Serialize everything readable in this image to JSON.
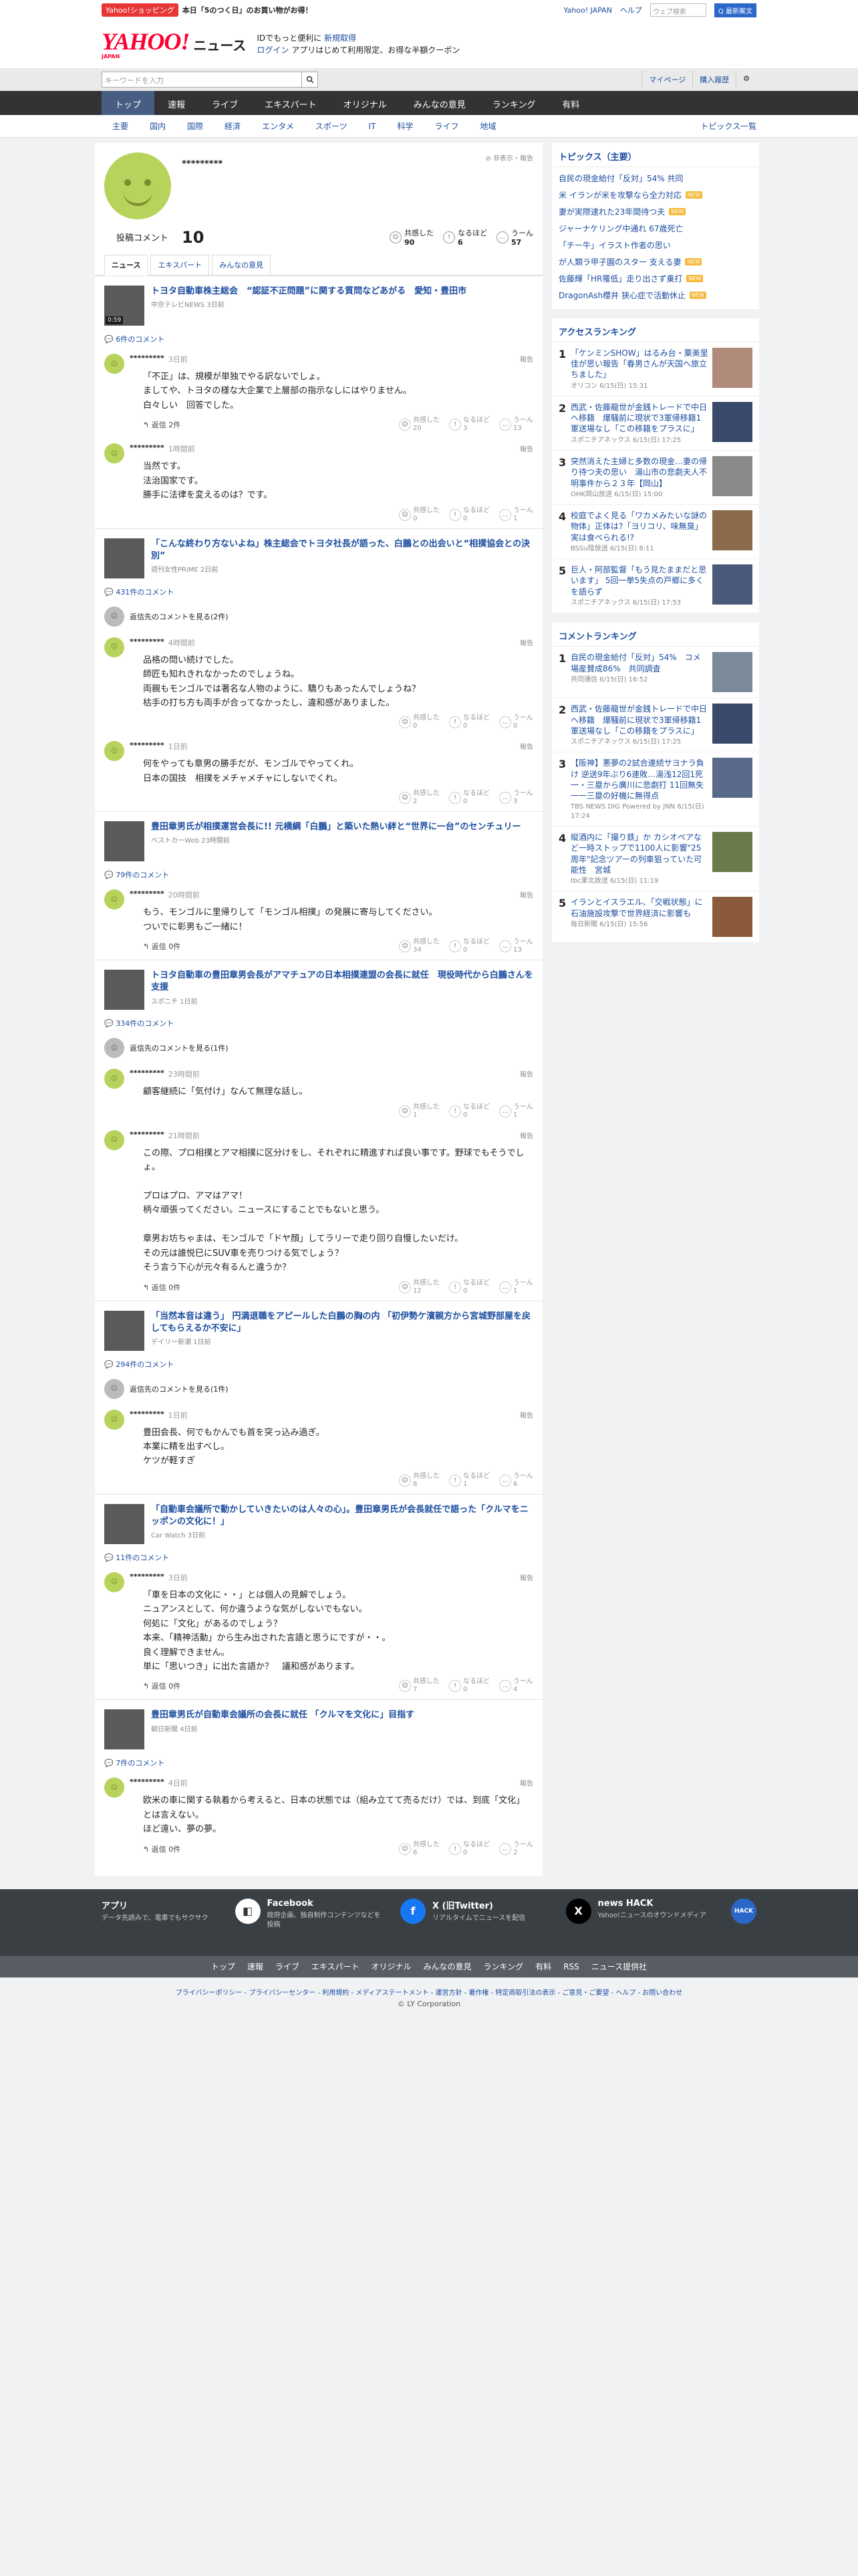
{
  "topbar": {
    "shop_badge": "Yahoo!ショッピング",
    "promo": "本日「5のつく日」のお買い物がお得！",
    "yahoo_japan": "Yahoo! JAPAN",
    "help": "ヘルプ",
    "search_placeholder": "ウェブ検索",
    "search_btn": "Q 最新案文"
  },
  "header": {
    "logo": "YAHOO!",
    "logo_sub": "JAPAN",
    "news": "ニュース",
    "msg1": "IDでもっと便利に",
    "msg1_link": "新規取得",
    "login": "ログイン",
    "msg2": "アプリはじめて利用限定、お得な半額クーポン"
  },
  "search": {
    "placeholder": "キーワードを入力",
    "mypage": "マイページ",
    "history": "購入履歴"
  },
  "gnav": [
    "トップ",
    "速報",
    "ライブ",
    "エキスパート",
    "オリジナル",
    "みんなの意見",
    "ランキング",
    "有料"
  ],
  "snav": [
    "主要",
    "国内",
    "国際",
    "経済",
    "エンタメ",
    "スポーツ",
    "IT",
    "科学",
    "ライフ",
    "地域"
  ],
  "snav_right": "トピックス一覧",
  "profile": {
    "name": "*********",
    "report": "非表示・報告",
    "comment_label": "投稿コメント",
    "comment_count": "10",
    "reacts": [
      {
        "label": "共感した",
        "count": "90"
      },
      {
        "label": "なるほど",
        "count": "6"
      },
      {
        "label": "うーん",
        "count": "57"
      }
    ]
  },
  "tabs": [
    "ニュース",
    "エキスパート",
    "みんなの意見"
  ],
  "reply_btn": "返信 2件",
  "report": "報告",
  "see_parent": "返信先のコメントを見る(2件)",
  "articles": [
    {
      "title": "トヨタ自動車株主総会　“認証不正問題”に関する質問などあがる　愛知・豊田市",
      "source": "中京テレビNEWS 3日前",
      "ccount": "6件のコメント",
      "vid": "0:59"
    },
    {
      "title": "「こんな終わり方ないよね」株主総会でトヨタ社長が語った、白鵬との出会いと“相撲協会との決別”",
      "source": "週刊女性PRIME 2日前",
      "ccount": "431件のコメント"
    },
    {
      "title": "豊田章男氏が相撲運営会長に!! 元横綱「白鵬」と築いた熱い絆と“世界に一台”のセンチュリー",
      "source": "ベストカーWeb 23時間前",
      "ccount": "79件のコメント"
    },
    {
      "title": "トヨタ自動車の豊田章男会長がアマチュアの日本相撲連盟の会長に就任　現役時代から白鵬さんを支援",
      "source": "スポニチ 1日前",
      "ccount": "334件のコメント"
    },
    {
      "title": "「当然本音は違う」 円満退職をアピールした白鵬の胸の内 「初伊勢ケ濱親方から宮城野部屋を戻してもらえるか不安に」",
      "source": "デイリー新潮 1日前",
      "ccount": "294件のコメント"
    },
    {
      "title": "「自動車会議所で動かしていきたいのは人々の心」。豊田章男氏が会長就任で語った「クルマをニッポンの文化に！」",
      "source": "Car Watch 3日前",
      "ccount": "11件のコメント"
    },
    {
      "title": "豊田章男氏が自動車会議所の会長に就任 「クルマを文化に」目指す",
      "source": "朝日新聞 4日前",
      "ccount": "7件のコメント"
    }
  ],
  "comments": [
    {
      "user": "*********",
      "time": "3日前",
      "text": "「不正」は、規模が単独でやる訳ないでしょ。\nましてや、トヨタの様な大企業で上層部の指示なしにはやりません。\n白々しい　回答でした。",
      "reply": "返信 2件",
      "r": [
        "20",
        "3",
        "13"
      ]
    },
    {
      "user": "*********",
      "time": "1時間前",
      "text": "当然です。\n法治国家です。\n勝手に法律を変えるのは？です。",
      "r": [
        "0",
        "0",
        "1"
      ]
    },
    {
      "user": "*********",
      "time": "4時間前",
      "text": "品格の問い続けでした。\n師匠も知れきれなかったのでしょうね。\n両親もモンゴルでは著名な人物のように、驕りもあったんでしょうね？\n枯手の打ち方も両手が合ってなかったし、違和感がありました。",
      "r": [
        "0",
        "0",
        "0"
      ]
    },
    {
      "user": "*********",
      "time": "1日前",
      "text": "何をやっても章男の勝手だが、モンゴルでやってくれ。\n日本の国技　相撲をメチャメチャにしないでくれ。",
      "r": [
        "2",
        "0",
        "3"
      ]
    },
    {
      "user": "*********",
      "time": "20時間前",
      "text": "もう、モンゴルに里帰りして「モンゴル相撲」の発展に寄与してください。\nついでに彰男もご一緒に！",
      "reply": "返信 0件",
      "r": [
        "34",
        "0",
        "13"
      ]
    },
    {
      "user": "*********",
      "time": "23時間前",
      "text": "顧客継続に「気付け」なんて無理な話し。",
      "r": [
        "1",
        "0",
        "1"
      ]
    },
    {
      "user": "*********",
      "time": "21時間前",
      "text": "この際、プロ相撲とアマ相撲に区分けをし、それぞれに精進すれば良い事です。野球でもそうでしょ。\n\nプロはプロ、アマはアマ！\n柄々頑張ってください。ニュースにすることでもないと思う。\n\n章男お坊ちゃまは、モンゴルで「ドヤ顔」してラリーで走り回り自慢したいだけ。\nその元は誰悦巳にSUV車を売りつける気でしょう？\nそう言う下心が元々有るんと違うか？",
      "reply": "返信 0件",
      "r": [
        "12",
        "0",
        "1"
      ]
    },
    {
      "user": "*********",
      "time": "1日前",
      "text": "豊田会長、何でもかんでも首を突っ込み過ぎ。\n本業に精を出すべし。\nケツが軽すぎ",
      "r": [
        "8",
        "1",
        "6"
      ]
    },
    {
      "user": "*********",
      "time": "3日前",
      "text": "「車を日本の文化に・・」とは個人の見解でしょう。\nニュアンスとして、何か違うような気がしないでもない。\n何処に「文化」があるのでしょう？\n本来、「精神活動」から生み出された言語と思うにですが・・。\n良く理解できません。\n単に「思いつき」に出た言語か？　議和感があります。",
      "reply": "返信 0件",
      "r": [
        "7",
        "0",
        "4"
      ]
    },
    {
      "user": "*********",
      "time": "4日前",
      "text": "欧米の車に関する執着から考えると、日本の状態では（組み立てて売るだけ）では、到底「文化」とは言えない。\nほど遠い、夢の夢。",
      "reply": "返信 0件",
      "r": [
        "6",
        "0",
        "2"
      ]
    }
  ],
  "side": {
    "topics_title": "トピックス（主要）",
    "topics": [
      "自民の現金給付「反対」54% 共同",
      "米 イランが米を攻撃なら全力対応",
      "妻が実際逮れた23年間待つ夫",
      "ジャーナケリング中通れ 67歳死亡",
      "「チー牛」イラスト作者の思い",
      "が人類ラ甲子園のスター 支える妻",
      "佐藤輝「HR罹低」走り出さず乗打",
      "DragonAsh櫻井 狭心症で活動休止"
    ],
    "access_title": "アクセスランキング",
    "access": [
      {
        "t": "「ケンミンSHOW」はるみ台・粟美里佳が思い報告「春男さんが天国へ旅立ちました」",
        "m": "オリコン 6/15(日) 15:31"
      },
      {
        "t": "西武・佐藤龍世が金銭トレードで中日へ移籍　爆騒前に現状で3軍帰移籍1軍送場なし「この移籍をプラスに」",
        "m": "スポニチアネックス 6/15(日) 17:25"
      },
      {
        "t": "突然消えた主婦と多数の現金…妻の帰り待つ夫の思い　湯山市の悲劇夫人不明事件から２３年【岡山】",
        "m": "OHK岡山放送 6/15(日) 15:00"
      },
      {
        "t": "校庭でよく見る「ワカメみたいな謎の物体」正体は?「ヨリコリ、味無臭」実は食べられる!?",
        "m": "BSSu陰放送 6/15(日) 8:11"
      },
      {
        "t": "巨人・阿部監督「もう見たままだと思います」 5回一挙5失点の戸郷に多くを語らず",
        "m": "スポニチアネックス 6/15(日) 17:53"
      }
    ],
    "comment_title": "コメントランキング",
    "crank": [
      {
        "t": "自民の現金給付「反対」54%　コメ場産賛成86%　共同調査",
        "m": "共同通信 6/15(日) 16:52"
      },
      {
        "t": "西武・佐藤龍世が金銭トレードで中日へ移籍　爆騒前に現状で3軍帰移籍1軍送場なし「この移籍をプラスに」",
        "m": "スポニチアネックス 6/15(日) 17:25"
      },
      {
        "t": "【阪神】悪夢の2試合連続サヨナラ負け 逆送9年ぶり6連敗…湯浅12回1死一・三塁から廣川に悲劇打 11回無失一一三塁の好機に無得点",
        "m": "TBS NEWS DIG Powered by JNN 6/15(日) 17:24"
      },
      {
        "t": "縦酒内に「撮り鉄」か カシオペアなど一時ストップで1100人に影響\"25周年\"記念ツアーの列車狙っていた可能性　宮城",
        "m": "tbc東北放送 6/15(日) 11:19"
      },
      {
        "t": "イランとイスラエル、「交戦状態」に　石油施設攻撃で世界経済に影響も",
        "m": "毎日新聞 6/15(日) 15:56"
      }
    ]
  },
  "footer": {
    "apps": [
      {
        "title": "アプリ",
        "desc": "データ先読みで、電車でもサクサク"
      },
      {
        "title": "Facebook",
        "desc": "政府企画、独自制作コンテンツなどを投稿"
      },
      {
        "title": "X (旧Twitter)",
        "desc": "リアルタイムでニュースを配信"
      },
      {
        "title": "news HACK",
        "desc": "Yahoo!ニュースのオウンドメディア"
      }
    ],
    "links": [
      "トップ",
      "速報",
      "ライブ",
      "エキスパート",
      "オリジナル",
      "みんなの意見",
      "ランキング",
      "有料",
      "RSS",
      "ニュース提供社"
    ],
    "legal": "プライバシーポリシー - プライバシーセンター - 利用規約 - メディアステートメント - 運営方針 - 著作権 - 特定商取引法の表示 - ご意見・ご要望 - ヘルプ - お問い合わせ",
    "copyright": "© LY Corporation"
  },
  "react_labels": [
    "共感した",
    "なるほど",
    "うーん"
  ]
}
